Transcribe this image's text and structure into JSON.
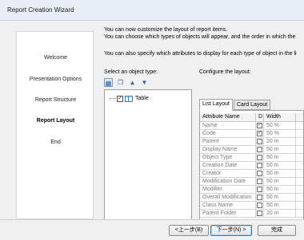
{
  "window": {
    "title": "Report Creation Wizard"
  },
  "sidebar": {
    "items": [
      {
        "label": "Welcome",
        "active": false
      },
      {
        "label": "Presentation Options",
        "active": false
      },
      {
        "label": "Report Structure",
        "active": false
      },
      {
        "label": "Report Layout",
        "active": true
      },
      {
        "label": "End",
        "active": false
      }
    ]
  },
  "intro": {
    "line1": "You can now customize the layout of report items.",
    "line2": "You can choose which types of objects will appear, and the order in which the",
    "line3": "You can also specify which attributes to display for each type of object in the li"
  },
  "object_panel": {
    "label": "Select an object type:",
    "toolbar_icons": [
      "select-all-icon",
      "copy-icon",
      "move-up-icon",
      "move-down-icon"
    ],
    "tree": {
      "label": "Table",
      "checked": "✓"
    }
  },
  "layout_panel": {
    "label": "Configure the layout:",
    "tabs": [
      "List Layout",
      "Card Layout"
    ],
    "active_tab": "List Layout",
    "columns": [
      "Attribute Name",
      "D",
      "Width"
    ],
    "rows": [
      {
        "name": "Name",
        "displayed": "✓",
        "width": "50 %"
      },
      {
        "name": "Code",
        "displayed": "✓",
        "width": "50 %"
      },
      {
        "name": "Parent",
        "displayed": "",
        "width": "20 m"
      },
      {
        "name": "Display Name",
        "displayed": "",
        "width": "50 m"
      },
      {
        "name": "Object Type",
        "displayed": "",
        "width": "50 m"
      },
      {
        "name": "Creation Date",
        "displayed": "",
        "width": "50 m"
      },
      {
        "name": "Creator",
        "displayed": "",
        "width": "50 m"
      },
      {
        "name": "Modification Date",
        "displayed": "",
        "width": "50 m"
      },
      {
        "name": "Modifier",
        "displayed": "",
        "width": "50 m"
      },
      {
        "name": "Overall Modification",
        "displayed": "",
        "width": "50 m"
      },
      {
        "name": "Class Name",
        "displayed": "",
        "width": "50 m"
      },
      {
        "name": "Parent Folder",
        "displayed": "",
        "width": "20 m"
      }
    ],
    "grid_toolbar": [
      "⇈",
      "↑",
      "↓",
      "⇊",
      "↓",
      "◂"
    ]
  },
  "footer": {
    "back": "<上一步(B)",
    "next": "下一步(N) >",
    "finish": "完成"
  }
}
